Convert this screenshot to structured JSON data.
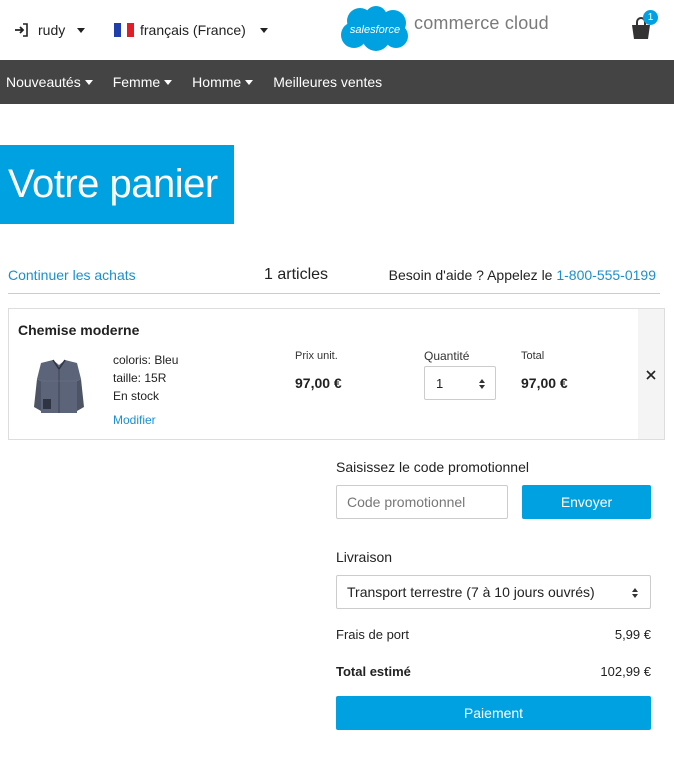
{
  "header": {
    "user_name": "rudy",
    "language": "français (France)",
    "logo_brand": "salesforce",
    "logo_product": "commerce cloud",
    "cart_count": "1"
  },
  "nav": {
    "items": [
      "Nouveautés",
      "Femme",
      "Homme",
      "Meilleures ventes"
    ]
  },
  "page": {
    "title": "Votre panier",
    "continue_link": "Continuer les achats",
    "item_count": "1 articles",
    "help_text": "Besoin d'aide ? Appelez le",
    "help_phone": "1-800-555-0199"
  },
  "cart_item": {
    "name": "Chemise moderne",
    "color": "coloris: Bleu",
    "size": "taille: 15R",
    "stock": "En stock",
    "modify_link": "Modifier",
    "unit_price_label": "Prix unit.",
    "unit_price": "97,00 €",
    "quantity_label": "Quantité",
    "quantity": "1",
    "total_label": "Total",
    "total": "97,00 €"
  },
  "summary": {
    "promo_label": "Saisissez le code promotionnel",
    "promo_placeholder": "Code promotionnel",
    "send_button": "Envoyer",
    "shipping_label": "Livraison",
    "shipping_option": "Transport terrestre (7 à 10 jours ouvrés)",
    "shipping_cost_label": "Frais de port",
    "shipping_cost": "5,99 €",
    "estimated_total_label": "Total estimé",
    "estimated_total": "102,99 €",
    "pay_button": "Paiement"
  },
  "colors": {
    "accent": "#00a1e0",
    "nav_bg": "#444444",
    "link": "#1a8fd1"
  }
}
